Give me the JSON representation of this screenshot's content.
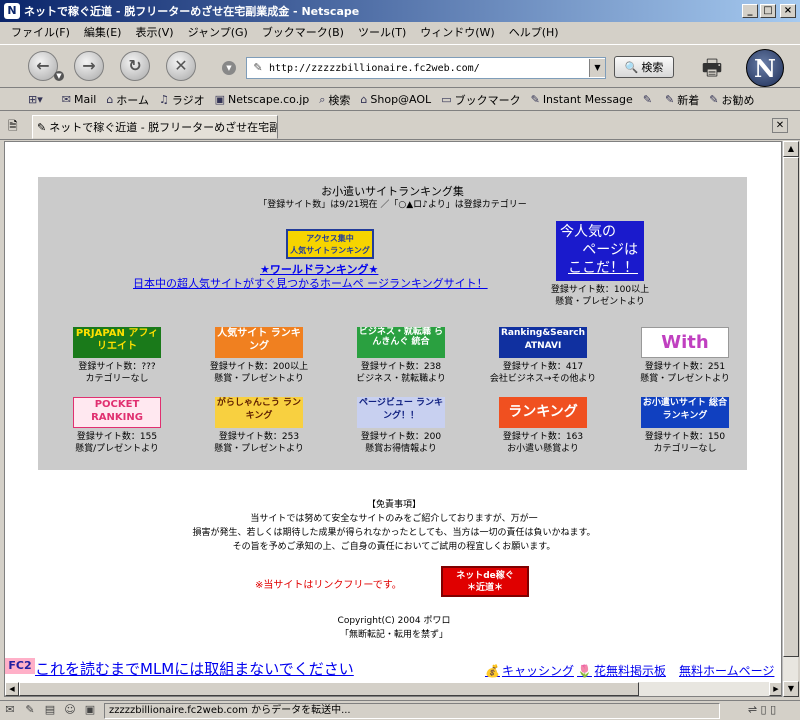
{
  "window": {
    "title": "ネットで稼ぐ近道 - 脱フリーターめざせ在宅副業成金 - Netscape",
    "app_icon": "N",
    "minimize": "_",
    "maximize": "□",
    "close": "×"
  },
  "menu": [
    "ファイル(F)",
    "編集(E)",
    "表示(V)",
    "ジャンプ(G)",
    "ブックマーク(B)",
    "ツール(T)",
    "ウィンドウ(W)",
    "ヘルプ(H)"
  ],
  "nav": {
    "url": "http://zzzzzbillionaire.fc2web.com/",
    "search_label": "検索",
    "logo": "N"
  },
  "personal_toolbar": [
    {
      "icon": "mail-icon",
      "label": "Mail"
    },
    {
      "icon": "home-icon",
      "label": "ホーム"
    },
    {
      "icon": "radio-icon",
      "label": "ラジオ"
    },
    {
      "icon": "my-icon",
      "label": "Netscape.co.jp"
    },
    {
      "icon": "search-icon",
      "label": "検索"
    },
    {
      "icon": "shop-icon",
      "label": "Shop@AOL"
    },
    {
      "icon": "folder-icon",
      "label": "ブックマーク"
    },
    {
      "icon": "link-icon",
      "label": "Instant Message"
    },
    {
      "icon": "link-icon",
      "label": ""
    },
    {
      "icon": "link-icon",
      "label": "新着"
    },
    {
      "icon": "link-icon",
      "label": "お勧め"
    }
  ],
  "tab": {
    "label": "ネットで稼ぐ近道 - 脱フリーターめざせ在宅副..."
  },
  "page": {
    "panel_title": "お小遣いサイトランキング集",
    "panel_subtitle": "「登録サイト数」は9/21現在 ／「○▲ロ♪より」は登録カテゴリー",
    "featured": {
      "banner_line1": "アクセス集中",
      "banner_line2": "人気サイトランキング",
      "link": "★ワールドランキング★",
      "desc": "日本中の超人気サイトがすぐ見つかるホームペ ージランキングサイト！"
    },
    "popular": {
      "line1": "今人気の",
      "line2": "ページは",
      "line3": "ここだ！！",
      "count": "登録サイト数：100以上",
      "category": "懸賞・プレゼントより"
    },
    "rankings_row1": [
      {
        "banner": "PRJAPAN アフィリエイト",
        "count": "登録サイト数：???",
        "category": "カテゴリーなし",
        "bg": "#1a7a1a",
        "fg": "#ffe000"
      },
      {
        "banner": "人気サイト ランキング",
        "count": "登録サイト数：200以上",
        "category": "懸賞・プレゼントより",
        "bg": "#f08020",
        "fg": "#ffffff"
      },
      {
        "banner": "ビジネス・就転職 らんきんぐ 統合",
        "count": "登録サイト数：238",
        "category": "ビジネス・就転職より",
        "bg": "#2aa040",
        "fg": "#ffffff"
      },
      {
        "banner": "Ranking&Search ATNAVI",
        "count": "登録サイト数：417",
        "category": "会社ビジネス→その他より",
        "bg": "#1030a0",
        "fg": "#ffffff"
      },
      {
        "banner": "With",
        "count": "登録サイト数：251",
        "category": "懸賞・プレゼントより",
        "bg": "#ffffff",
        "fg": "#c040c0"
      }
    ],
    "rankings_row2": [
      {
        "banner": "POCKET RANKING",
        "count": "登録サイト数：155",
        "category": "懸賞/プレゼントより",
        "bg": "#ffe8f0",
        "fg": "#e03070"
      },
      {
        "banner": "がらしゃんこう ランキング",
        "count": "登録サイト数：253",
        "category": "懸賞・プレゼントより",
        "bg": "#f8d040",
        "fg": "#602000"
      },
      {
        "banner": "ページビュー ランキング！！",
        "count": "登録サイト数：200",
        "category": "懸賞お得情報より",
        "bg": "#c8d0f0",
        "fg": "#102080"
      },
      {
        "banner": "ランキング",
        "count": "登録サイト数：163",
        "category": "お小遣い懸賞より",
        "bg": "#f05020",
        "fg": "#ffffff"
      },
      {
        "banner": "お小遣いサイト 総合ランキング",
        "count": "登録サイト数：150",
        "category": "カテゴリーなし",
        "bg": "#1040c0",
        "fg": "#ffffff"
      }
    ],
    "disclaimer": {
      "heading": "【免責事項】",
      "line1": "当サイトでは努めて安全なサイトのみをご紹介しておりますが、万が一",
      "line2": "損害が発生、若しくは期待した成果が得られなかったとしても、当方は一切の責任は負いかねます。",
      "line3": "その旨を予めご承知の上、ご自身の責任においてご試用の程宜しくお願います。"
    },
    "link_free": "※当サイトはリンクフリーです。",
    "net_banner_line1": "ネットde稼ぐ",
    "net_banner_line2": "＊近道＊",
    "copyright": "Copyright(C) 2004 ポワロ",
    "copyright_note": "「無断転記・転用を禁ず」"
  },
  "footer": {
    "fc2_logo": "FC2",
    "fc2_link": "これを読むまでMLMには取組まないでください",
    "cashing": "キャッシング",
    "flower": "花無料掲示板",
    "homepage": "無料ホームページ"
  },
  "status": {
    "text": "zzzzzbillionaire.fc2web.com からデータを転送中..."
  },
  "colors": {
    "titlebar_start": "#0a246a",
    "link": "#0000ee",
    "panel_bg": "#cbcbcb",
    "link_free": "#e00000"
  }
}
